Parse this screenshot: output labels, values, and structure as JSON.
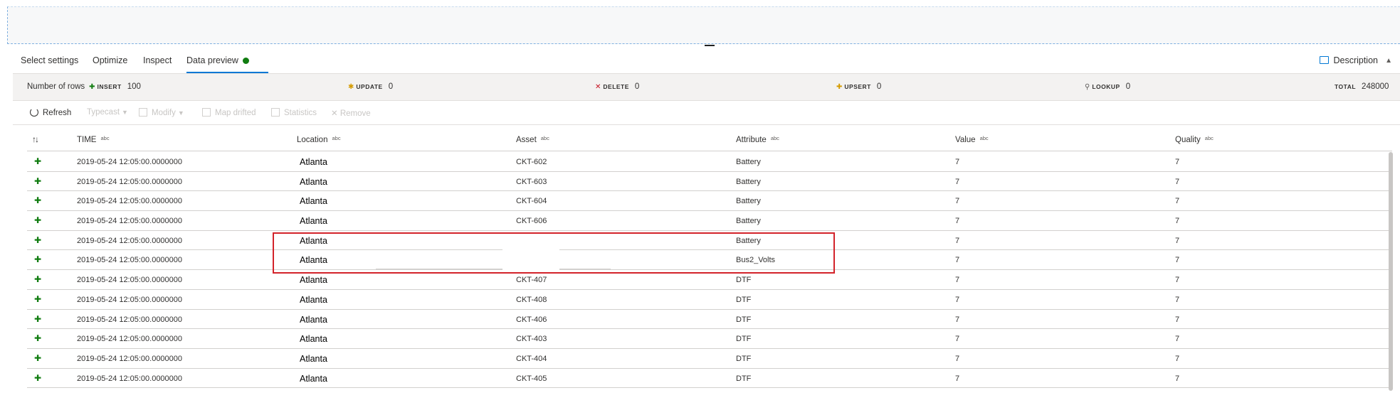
{
  "tabs": [
    {
      "label": "Select settings"
    },
    {
      "label": "Optimize"
    },
    {
      "label": "Inspect"
    },
    {
      "label": "Data preview",
      "active": true
    }
  ],
  "description_label": "Description",
  "stats": {
    "rows_label": "Number of rows",
    "insert_label": "INSERT",
    "insert_value": "100",
    "update_label": "UPDATE",
    "update_value": "0",
    "delete_label": "DELETE",
    "delete_value": "0",
    "upsert_label": "UPSERT",
    "upsert_value": "0",
    "lookup_label": "LOOKUP",
    "lookup_value": "0",
    "total_label": "TOTAL",
    "total_value": "248000"
  },
  "toolbar": {
    "refresh": "Refresh",
    "typecast": "Typecast",
    "modify": "Modify",
    "map_drifted": "Map drifted",
    "statistics": "Statistics",
    "remove": "Remove"
  },
  "columns": [
    {
      "name": "TIME",
      "type": "abc"
    },
    {
      "name": "Location",
      "type": "abc"
    },
    {
      "name": "Asset",
      "type": "abc"
    },
    {
      "name": "Attribute",
      "type": "abc"
    },
    {
      "name": "Value",
      "type": "abc"
    },
    {
      "name": "Quality",
      "type": "abc"
    }
  ],
  "rows": [
    {
      "time": "2019-05-24 12:05:00.0000000",
      "location": "Atlanta",
      "asset": "CKT-602",
      "attribute": "Battery",
      "value": "7",
      "quality": "7"
    },
    {
      "time": "2019-05-24 12:05:00.0000000",
      "location": "Atlanta",
      "asset": "CKT-603",
      "attribute": "Battery",
      "value": "7",
      "quality": "7"
    },
    {
      "time": "2019-05-24 12:05:00.0000000",
      "location": "Atlanta",
      "asset": "CKT-604",
      "attribute": "Battery",
      "value": "7",
      "quality": "7"
    },
    {
      "time": "2019-05-24 12:05:00.0000000",
      "location": "Atlanta",
      "asset": "CKT-606",
      "attribute": "Battery",
      "value": "7",
      "quality": "7"
    },
    {
      "time": "2019-05-24 12:05:00.0000000",
      "location": "Atlanta",
      "asset": "",
      "attribute": "Battery",
      "value": "7",
      "quality": "7"
    },
    {
      "time": "2019-05-24 12:05:00.0000000",
      "location": "Atlanta",
      "asset": "",
      "attribute": "Bus2_Volts",
      "value": "7",
      "quality": "7"
    },
    {
      "time": "2019-05-24 12:05:00.0000000",
      "location": "Atlanta",
      "asset": "CKT-407",
      "attribute": "DTF",
      "value": "7",
      "quality": "7"
    },
    {
      "time": "2019-05-24 12:05:00.0000000",
      "location": "Atlanta",
      "asset": "CKT-408",
      "attribute": "DTF",
      "value": "7",
      "quality": "7"
    },
    {
      "time": "2019-05-24 12:05:00.0000000",
      "location": "Atlanta",
      "asset": "CKT-406",
      "attribute": "DTF",
      "value": "7",
      "quality": "7"
    },
    {
      "time": "2019-05-24 12:05:00.0000000",
      "location": "Atlanta",
      "asset": "CKT-403",
      "attribute": "DTF",
      "value": "7",
      "quality": "7"
    },
    {
      "time": "2019-05-24 12:05:00.0000000",
      "location": "Atlanta",
      "asset": "CKT-404",
      "attribute": "DTF",
      "value": "7",
      "quality": "7"
    },
    {
      "time": "2019-05-24 12:05:00.0000000",
      "location": "Atlanta",
      "asset": "CKT-405",
      "attribute": "DTF",
      "value": "7",
      "quality": "7"
    }
  ],
  "colors": {
    "accent": "#0078d4",
    "insert": "#107c10",
    "highlight": "#d3232a"
  }
}
